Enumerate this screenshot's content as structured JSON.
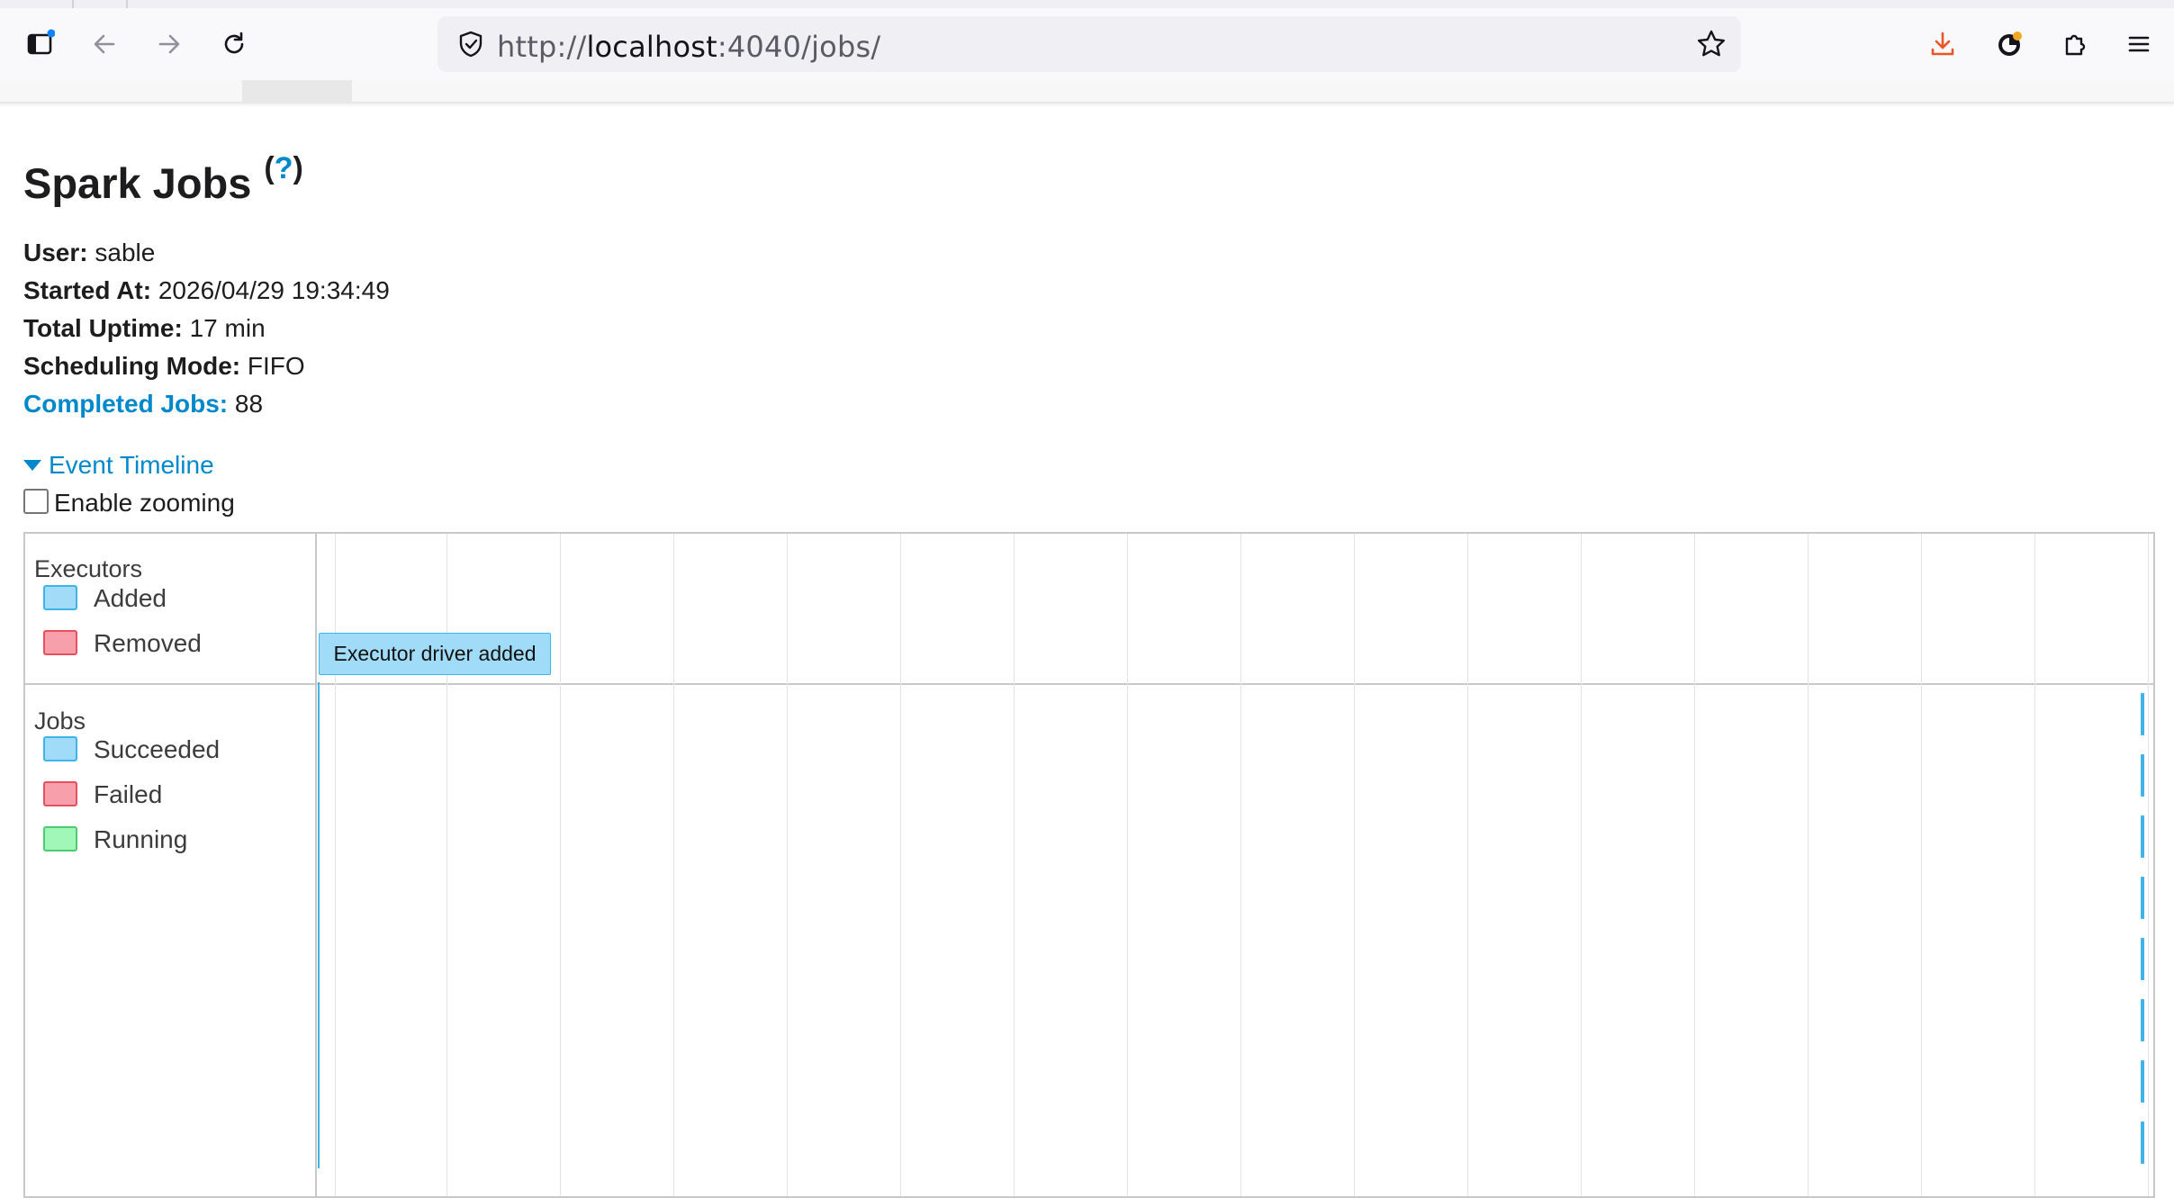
{
  "browser": {
    "url_scheme": "http://",
    "url_host": "localhost",
    "url_rest": ":4040/jobs/",
    "icons": [
      "sidebar-icon",
      "back-arrow-icon",
      "forward-arrow-icon",
      "reload-icon",
      "shield-icon",
      "bookmark-star-icon",
      "download-icon",
      "account-icon",
      "extensions-icon",
      "menu-icon"
    ]
  },
  "spark_nav": {
    "logo_fragment": "′",
    "tab_fragment": "···"
  },
  "page": {
    "title": "Spark Jobs",
    "help_open": "(",
    "help_link": "?",
    "help_close": ")"
  },
  "summary": {
    "user_label": "User:",
    "user_value": "sable",
    "started_label": "Started At:",
    "started_value": "2026/04/29 19:34:49",
    "uptime_label": "Total Uptime:",
    "uptime_value": "17 min",
    "sched_label": "Scheduling Mode:",
    "sched_value": "FIFO",
    "completed_label": "Completed Jobs:",
    "completed_value": "88"
  },
  "timeline": {
    "toggle_label": "Event Timeline",
    "zoom_label": "Enable zooming",
    "zoom_checked": false,
    "executors": {
      "title": "Executors",
      "legend": [
        {
          "label": "Added",
          "fill": "#a0dcf8",
          "border": "#3eb4e8"
        },
        {
          "label": "Removed",
          "fill": "#f7a0ac",
          "border": "#e8505e"
        }
      ],
      "event_label": "Executor driver added"
    },
    "jobs": {
      "title": "Jobs",
      "legend": [
        {
          "label": "Succeeded",
          "fill": "#a0dcf8",
          "border": "#3eb4e8"
        },
        {
          "label": "Failed",
          "fill": "#f7a0ac",
          "border": "#e8505e"
        },
        {
          "label": "Running",
          "fill": "#a0f7b8",
          "border": "#4ccc70"
        }
      ],
      "visible_job_marks": 8
    }
  }
}
